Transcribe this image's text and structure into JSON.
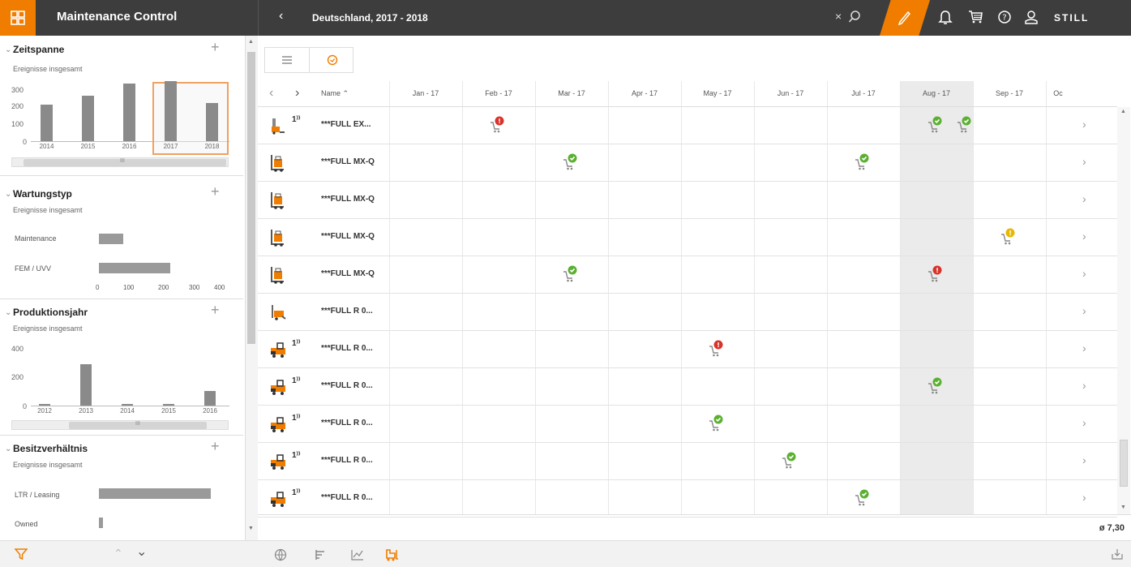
{
  "app": {
    "title": "Maintenance Control",
    "breadcrumb": "Deutschland, 2017 - 2018",
    "brand": "STILL",
    "accent": "#f07d00"
  },
  "sidebar": {
    "zeitspanne": {
      "title": "Zeitspanne",
      "sub": "Ereignisse insgesamt",
      "yticks": [
        "300",
        "200",
        "100",
        "0"
      ],
      "years": [
        "2014",
        "2015",
        "2016",
        "2017",
        "2018"
      ],
      "values": [
        150,
        185,
        235,
        245,
        155
      ],
      "scroll_mark": "III"
    },
    "wartungstyp": {
      "title": "Wartungstyp",
      "sub": "Ereignisse insgesamt",
      "items": [
        {
          "label": "Maintenance",
          "value": 80
        },
        {
          "label": "FEM / UVV",
          "value": 235
        }
      ],
      "xticks": [
        "0",
        "100",
        "200",
        "300",
        "400"
      ]
    },
    "produktionsjahr": {
      "title": "Produktionsjahr",
      "sub": "Ereignisse insgesamt",
      "yticks": [
        "400",
        "200",
        "0"
      ],
      "years": [
        "2012",
        "2013",
        "2014",
        "2015",
        "2016"
      ],
      "values": [
        5,
        270,
        10,
        10,
        95
      ],
      "scroll_mark": "III"
    },
    "besitz": {
      "title": "Besitzverhältnis",
      "sub": "Ereignisse insgesamt",
      "items": [
        {
          "label": "LTR / Leasing",
          "value": 300
        },
        {
          "label": "Owned",
          "value": 10
        }
      ]
    }
  },
  "grid": {
    "sort_label": "Name",
    "months": [
      "Jan - 17",
      "Feb - 17",
      "Mar - 17",
      "Apr - 17",
      "May - 17",
      "Jun - 17",
      "Jul - 17",
      "Aug - 17",
      "Sep - 17",
      "Oc"
    ],
    "rows": [
      {
        "name": "***FULL EX...",
        "truck": "ex",
        "ant": "1⁾⁾"
      },
      {
        "name": "***FULL MX-Q",
        "truck": "mx",
        "ant": ""
      },
      {
        "name": "***FULL MX-Q",
        "truck": "mx",
        "ant": ""
      },
      {
        "name": "***FULL MX-Q",
        "truck": "mx",
        "ant": ""
      },
      {
        "name": "***FULL MX-Q",
        "truck": "mx",
        "ant": ""
      },
      {
        "name": "***FULL R 0...",
        "truck": "r",
        "ant": ""
      },
      {
        "name": "***FULL R 0...",
        "truck": "rg",
        "ant": "1⁾⁾"
      },
      {
        "name": "***FULL R 0...",
        "truck": "rg",
        "ant": "1⁾⁾"
      },
      {
        "name": "***FULL R 0...",
        "truck": "rg",
        "ant": "1⁾⁾"
      },
      {
        "name": "***FULL R 0...",
        "truck": "rg",
        "ant": "1⁾⁾"
      },
      {
        "name": "***FULL R 0...",
        "truck": "rg",
        "ant": "1⁾⁾"
      }
    ],
    "events": [
      {
        "row": 0,
        "col": 1,
        "status": "error"
      },
      {
        "row": 0,
        "col": 7,
        "status": "ok"
      },
      {
        "row": 0,
        "col": 7.4,
        "status": "ok"
      },
      {
        "row": 1,
        "col": 2,
        "status": "ok"
      },
      {
        "row": 1,
        "col": 6,
        "status": "ok"
      },
      {
        "row": 3,
        "col": 8,
        "status": "warn"
      },
      {
        "row": 4,
        "col": 2,
        "status": "ok"
      },
      {
        "row": 4,
        "col": 7,
        "status": "error"
      },
      {
        "row": 6,
        "col": 4,
        "status": "error"
      },
      {
        "row": 7,
        "col": 7,
        "status": "ok"
      },
      {
        "row": 8,
        "col": 4,
        "status": "ok"
      },
      {
        "row": 9,
        "col": 5,
        "status": "ok"
      },
      {
        "row": 10,
        "col": 6,
        "status": "ok"
      }
    ],
    "average": "ø 7,30"
  }
}
